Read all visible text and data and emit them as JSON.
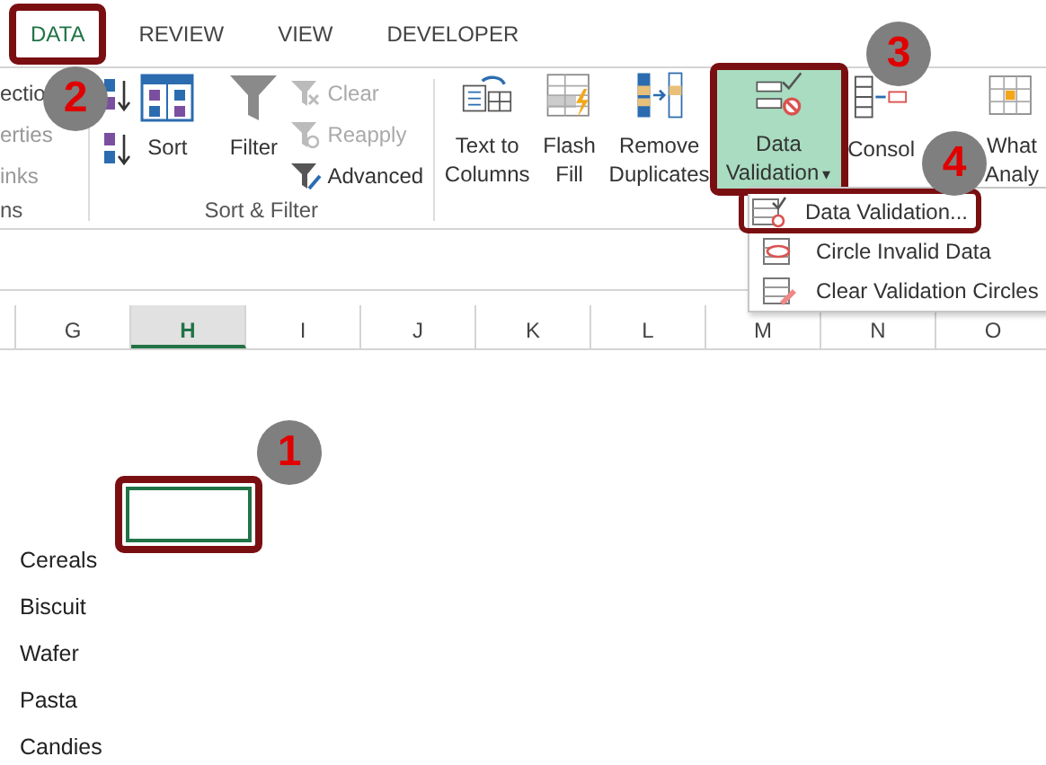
{
  "tabs": [
    {
      "label": "DATA",
      "selected": true,
      "annotated": true
    },
    {
      "label": "REVIEW",
      "selected": false,
      "annotated": false
    },
    {
      "label": "VIEW",
      "selected": false,
      "annotated": false
    },
    {
      "label": "DEVELOPER",
      "selected": false,
      "annotated": false
    }
  ],
  "connections_group": {
    "items": [
      "ectio",
      "erties",
      "inks"
    ],
    "label": "ns"
  },
  "sort_filter_group": {
    "label": "Sort & Filter",
    "sort": "Sort",
    "filter": "Filter",
    "small_items": [
      {
        "kind": "clear",
        "label": "Clear",
        "disabled": true
      },
      {
        "kind": "reapply",
        "label": "Reapply",
        "disabled": true
      },
      {
        "kind": "advanced",
        "label": "Advanced",
        "disabled": false
      }
    ]
  },
  "data_tools": [
    {
      "kind": "text-to-columns",
      "lines": [
        "Text to",
        "Columns"
      ],
      "selected": false,
      "annotated": false
    },
    {
      "kind": "flash-fill",
      "lines": [
        "Flash",
        "Fill"
      ],
      "selected": false,
      "annotated": false
    },
    {
      "kind": "remove-duplicates",
      "lines": [
        "Remove",
        "Duplicates"
      ],
      "selected": false,
      "annotated": false
    },
    {
      "kind": "data-validation",
      "lines": [
        "Data",
        "Validation"
      ],
      "caret": "▾",
      "selected": true,
      "annotated": true
    },
    {
      "kind": "consolidate",
      "lines": [
        "Consol"
      ],
      "selected": false,
      "annotated": false
    },
    {
      "kind": "what-if",
      "lines": [
        "What",
        "Analy"
      ],
      "selected": false,
      "annotated": false
    }
  ],
  "menu": {
    "items": [
      {
        "kind": "validation",
        "label": "Data Validation...",
        "annotated": true
      },
      {
        "kind": "circle",
        "label": "Circle Invalid Data",
        "annotated": false
      },
      {
        "kind": "clear-circles",
        "label": "Clear Validation Circles",
        "annotated": false
      }
    ]
  },
  "columns": [
    {
      "label": "G",
      "selected": false
    },
    {
      "label": "H",
      "selected": true
    },
    {
      "label": "I",
      "selected": false
    },
    {
      "label": "J",
      "selected": false
    },
    {
      "label": "K",
      "selected": false
    },
    {
      "label": "L",
      "selected": false
    },
    {
      "label": "M",
      "selected": false
    },
    {
      "label": "N",
      "selected": false
    },
    {
      "label": "O",
      "selected": false
    }
  ],
  "active_cell": {
    "annotated": true
  },
  "column_g_values": [
    "Cereals",
    "Biscuit",
    "Wafer",
    "Pasta",
    "Candies"
  ],
  "callouts": [
    "1",
    "2",
    "3",
    "4"
  ]
}
